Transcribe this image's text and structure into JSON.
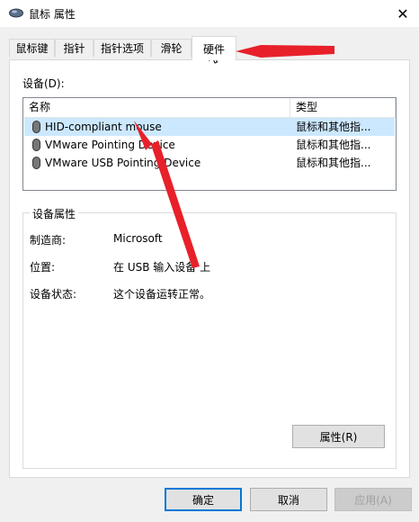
{
  "window": {
    "title": "鼠标 属性",
    "close_glyph": "✕"
  },
  "tabs": [
    {
      "label": "鼠标键",
      "active": false
    },
    {
      "label": "指针",
      "active": false
    },
    {
      "label": "指针选项",
      "active": false
    },
    {
      "label": "滑轮",
      "active": false
    },
    {
      "label": "硬件",
      "active": true
    }
  ],
  "devices": {
    "label": "设备(D):",
    "columns": [
      "名称",
      "类型"
    ],
    "rows": [
      {
        "name": "HID-compliant mouse",
        "type": "鼠标和其他指...",
        "icon": "mouse-icon",
        "selected": true
      },
      {
        "name": "VMware Pointing Device",
        "type": "鼠标和其他指...",
        "icon": "mouse-icon",
        "selected": false
      },
      {
        "name": "VMware USB Pointing Device",
        "type": "鼠标和其他指...",
        "icon": "mouse-icon",
        "selected": false
      }
    ]
  },
  "properties": {
    "title": "设备属性",
    "fields": [
      {
        "label": "制造商:",
        "value": "Microsoft"
      },
      {
        "label": "位置:",
        "value": "在 USB 输入设备 上"
      },
      {
        "label": "设备状态:",
        "value": "这个设备运转正常。"
      }
    ],
    "properties_button": "属性(R)"
  },
  "footer": {
    "ok": "确定",
    "cancel": "取消",
    "apply": "应用(A)"
  },
  "colors": {
    "selection": "#cce8ff",
    "annotation_arrow": "#e8202a",
    "default_button_border": "#0078d7"
  }
}
